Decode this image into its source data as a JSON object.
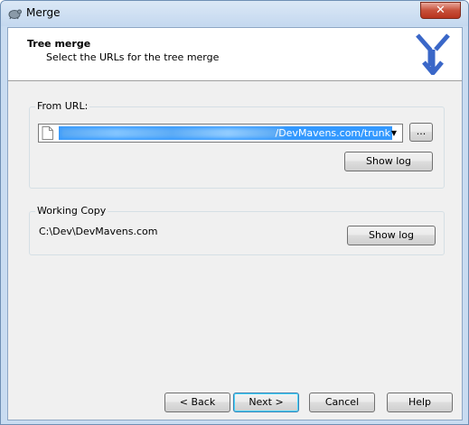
{
  "window": {
    "title": "Merge",
    "close_glyph": "✕"
  },
  "header": {
    "title": "Tree merge",
    "subtitle": "Select the URLs for the tree merge",
    "logo_icon": "merge-logo-icon"
  },
  "from_url": {
    "label": "From URL:",
    "value_visible": "/DevMavens.com/trunk",
    "browse_label": "...",
    "show_log_label": "Show log"
  },
  "working_copy": {
    "label": "Working Copy",
    "path": "C:\\Dev\\DevMavens.com",
    "show_log_label": "Show log"
  },
  "footer": {
    "back_label": "< Back",
    "next_label": "Next >",
    "cancel_label": "Cancel",
    "help_label": "Help"
  },
  "colors": {
    "selection": "#3399ff",
    "client_bg": "#f0f0f0",
    "frame": "#c9dcf1",
    "logo": "#3a67c8"
  }
}
